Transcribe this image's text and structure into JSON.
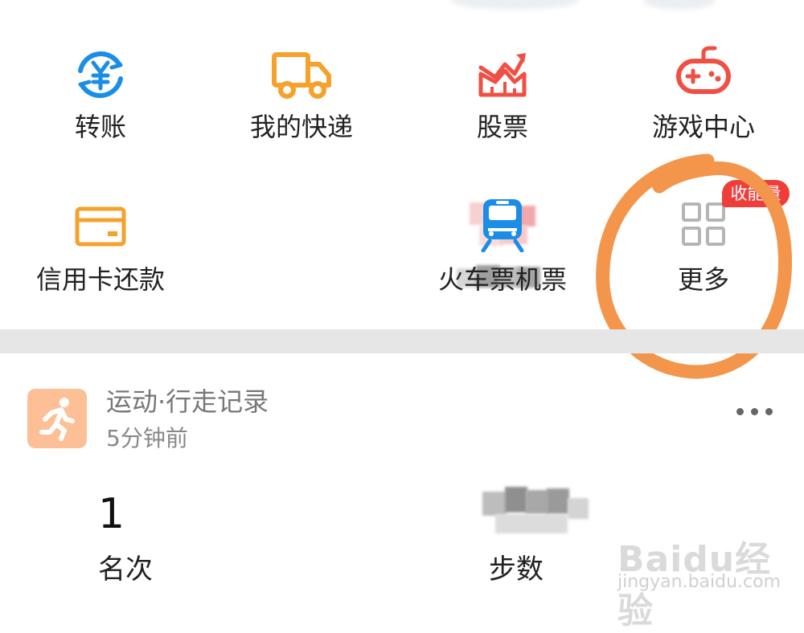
{
  "theme": {
    "blue": "#1a8ee6",
    "orange": "#f5a12b",
    "red": "#f04f43",
    "badge_red": "#ef3e3a",
    "annotation_orange": "#f3954a",
    "run_icon_bg": "#fdbf95",
    "divider": "#e6e6e6"
  },
  "services": {
    "row1": [
      {
        "label": "转账",
        "icon": "transfer-yuan-icon"
      },
      {
        "label": "我的快递",
        "icon": "delivery-truck-icon"
      },
      {
        "label": "股票",
        "icon": "stock-chart-icon"
      },
      {
        "label": "游戏中心",
        "icon": "gamepad-icon"
      }
    ],
    "row2": [
      {
        "label": "信用卡还款",
        "icon": "credit-card-icon"
      },
      {
        "label": "",
        "icon": "pixelated-icon"
      },
      {
        "label": "火车票机票",
        "icon": "train-icon"
      },
      {
        "label": "更多",
        "icon": "grid-more-icon"
      }
    ],
    "more_badge": "收能量"
  },
  "activity_card": {
    "title": "运动·行走记录",
    "subtitle": "5分钟前",
    "icon": "running-man-icon",
    "menu_icon": "more-dots-icon",
    "stats": [
      {
        "value": "1",
        "label": "名次"
      },
      {
        "value": "",
        "label": "步数"
      }
    ]
  },
  "watermark": {
    "logo": "Baidu经验",
    "url": "jingyan.baidu.com"
  }
}
